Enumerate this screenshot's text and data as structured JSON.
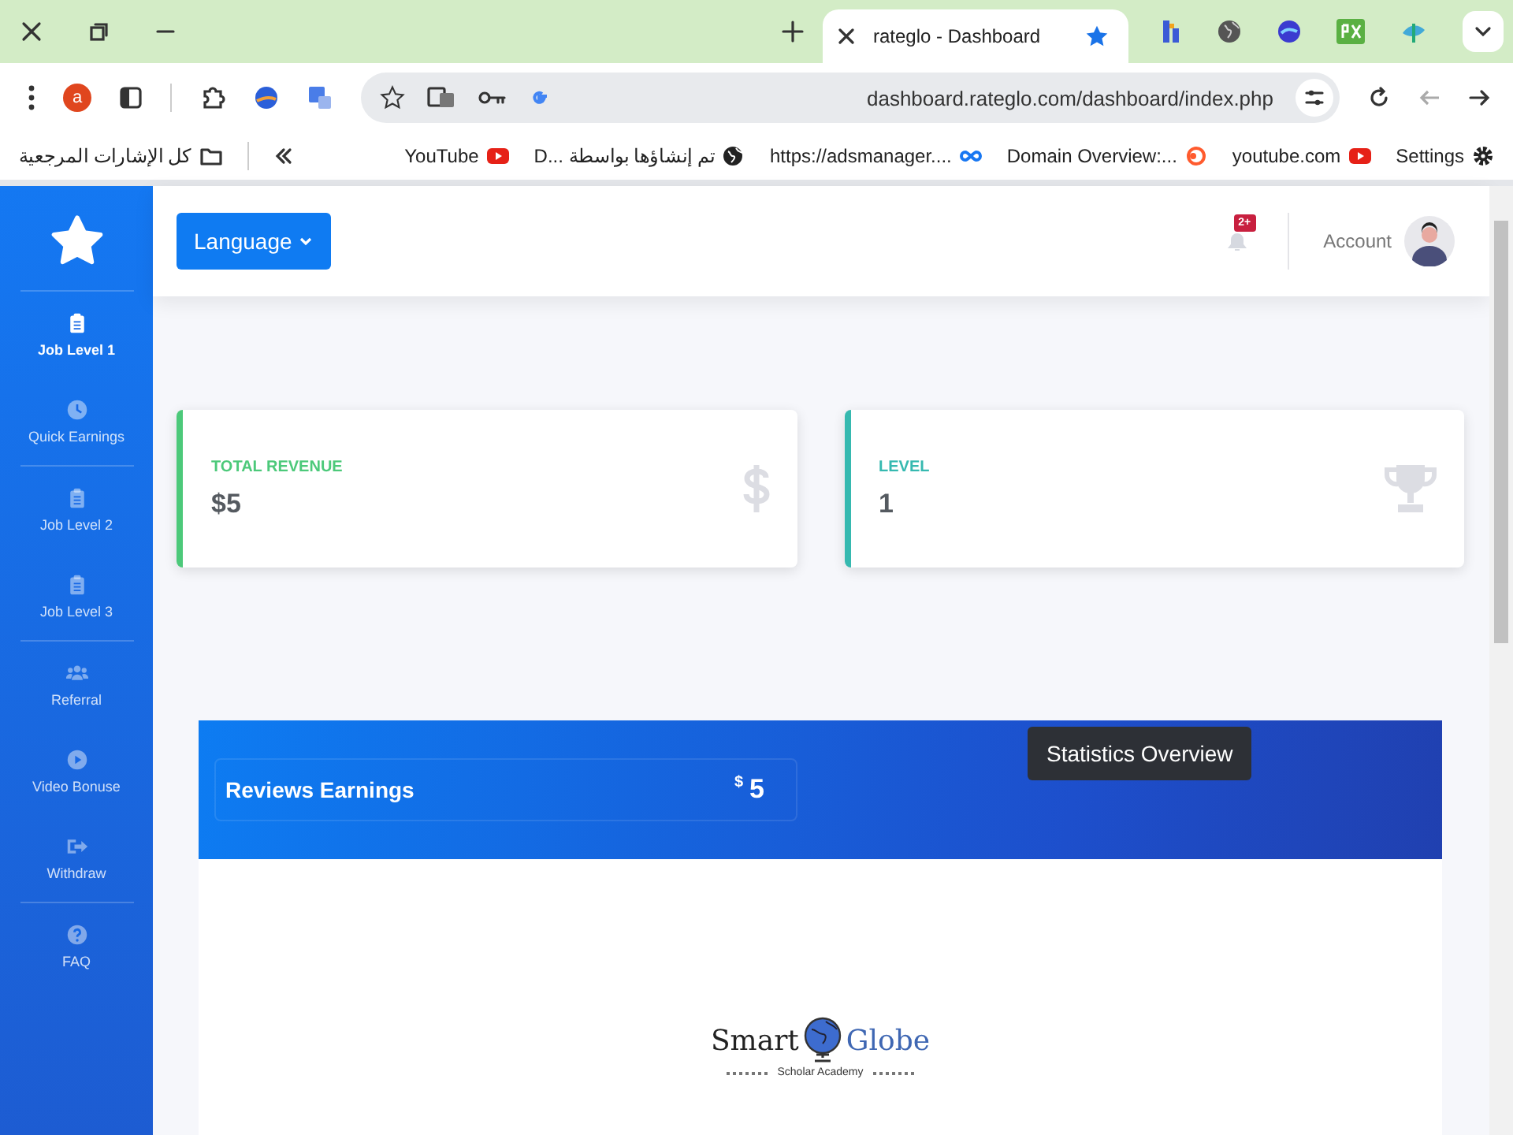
{
  "browser": {
    "tabs": [
      {
        "title": "rateglo - Dashboard",
        "selected": true
      }
    ],
    "address": {
      "url": "dashboard.rateglo.com/dashboard/index.php"
    },
    "profile": {
      "initial": "a"
    },
    "all_bookmarks": "كل الإشارات المرجعية",
    "bookmarks": [
      {
        "label": "YouTube"
      },
      {
        "label": "D... تم إنشاؤها بواسطة"
      },
      {
        "label": "https://adsmanager...."
      },
      {
        "label": "Domain Overview:..."
      },
      {
        "label": "youtube.com"
      },
      {
        "label": "Settings"
      }
    ]
  },
  "sidebar": {
    "groups": [
      [
        {
          "label": "Job Level 1",
          "selected": true
        },
        {
          "label": "Quick Earnings",
          "selected": false
        }
      ],
      [
        {
          "label": "Job Level 2",
          "selected": false
        },
        {
          "label": "Job Level 3",
          "selected": false
        }
      ],
      [
        {
          "label": "Referral",
          "selected": false
        },
        {
          "label": "Video Bonuse",
          "selected": false
        },
        {
          "label": "Withdraw",
          "selected": false
        }
      ],
      [
        {
          "label": "FAQ",
          "selected": false
        }
      ]
    ]
  },
  "topbar": {
    "language": "Language",
    "notifications_badge": "2+",
    "account": "Account"
  },
  "stats": [
    {
      "label": "TOTAL REVENUE",
      "value": "$5",
      "color": "#4cc97a"
    },
    {
      "label": "LEVEL",
      "value": "1",
      "color": "#36b9b0"
    }
  ],
  "earnings": {
    "label": "Reviews Earnings",
    "currency": "$",
    "amount": "5",
    "tooltip": "Statistics Overview"
  },
  "logo": {
    "word_1": "Smart",
    "word_2": "Globe",
    "tagline": "Scholar Academy"
  }
}
